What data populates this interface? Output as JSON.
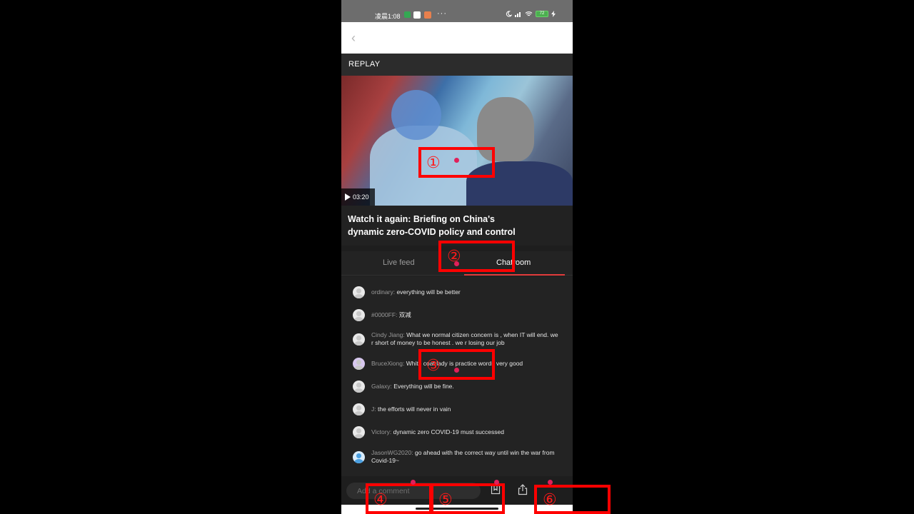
{
  "status_bar": {
    "time": "凌晨1:08",
    "more": "···",
    "battery": "72"
  },
  "header": {
    "back_icon": "chevron-left-icon"
  },
  "replay": {
    "label": "REPLAY"
  },
  "video": {
    "duration": "03:20",
    "play_icon": "play-icon",
    "title": "Watch it again: Briefing on China's dynamic zero-COVID policy and control"
  },
  "tabs": [
    {
      "label": "Live feed",
      "active": false
    },
    {
      "label": "Chatroom",
      "active": true
    }
  ],
  "chat": [
    {
      "user": "ordinary:",
      "message": "everything will be better"
    },
    {
      "user": "#0000FF:",
      "message": "双减"
    },
    {
      "user": "Cindy Jiang:",
      "message": "What we normal citizen concern is , when IT will end. we r short of money to be honest . we r losing our job"
    },
    {
      "user": "BruceXiong:",
      "message": "White coat lady is practice words very good"
    },
    {
      "user": "Galaxy:",
      "message": "Everything will be fine."
    },
    {
      "user": "J:",
      "message": "the efforts will never in vain"
    },
    {
      "user": "Victory:",
      "message": "dynamic zero COVID-19 must successed"
    },
    {
      "user": "JasonWG2020:",
      "message": "go ahead with the correct way until win the war from Covid-19~"
    }
  ],
  "bottom_bar": {
    "comment_placeholder": "Add a comment",
    "bookmark_icon": "bookmark-icon",
    "share_icon": "share-icon"
  },
  "annotations": [
    {
      "label": "①"
    },
    {
      "label": "②"
    },
    {
      "label": "③"
    },
    {
      "label": "④"
    },
    {
      "label": "⑤"
    },
    {
      "label": "⑥"
    }
  ],
  "colors": {
    "accent": "#e23c3c",
    "annotation": "#ff0000",
    "background": "#1e1e1e"
  }
}
